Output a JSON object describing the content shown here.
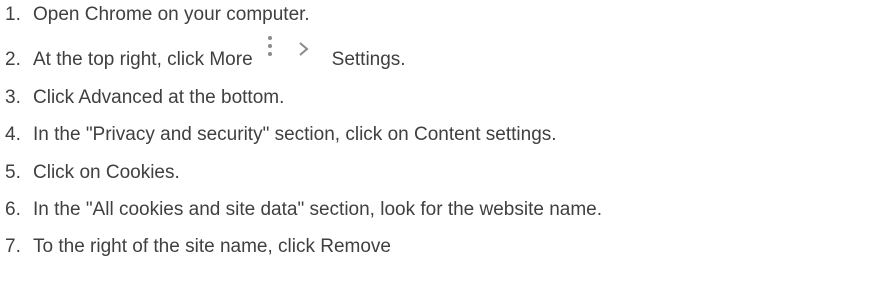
{
  "steps": [
    {
      "number": "1.",
      "text": "Open Chrome on your computer."
    },
    {
      "number": "2.",
      "text_before": "At the top right, click More",
      "icon1": "more-vertical-icon",
      "icon2": "chevron-right-icon",
      "text_after": "Settings."
    },
    {
      "number": "3.",
      "text": "Click Advanced at the bottom."
    },
    {
      "number": "4.",
      "text": "In the \"Privacy and security\" section, click on Content settings."
    },
    {
      "number": "5.",
      "text": "Click on Cookies."
    },
    {
      "number": "6.",
      "text": "In the \"All cookies and site data\" section, look for the website name."
    },
    {
      "number": "7.",
      "text": "To the right of the site name, click Remove"
    }
  ],
  "colors": {
    "text": "#404040",
    "icon": "#8a8a8a"
  }
}
